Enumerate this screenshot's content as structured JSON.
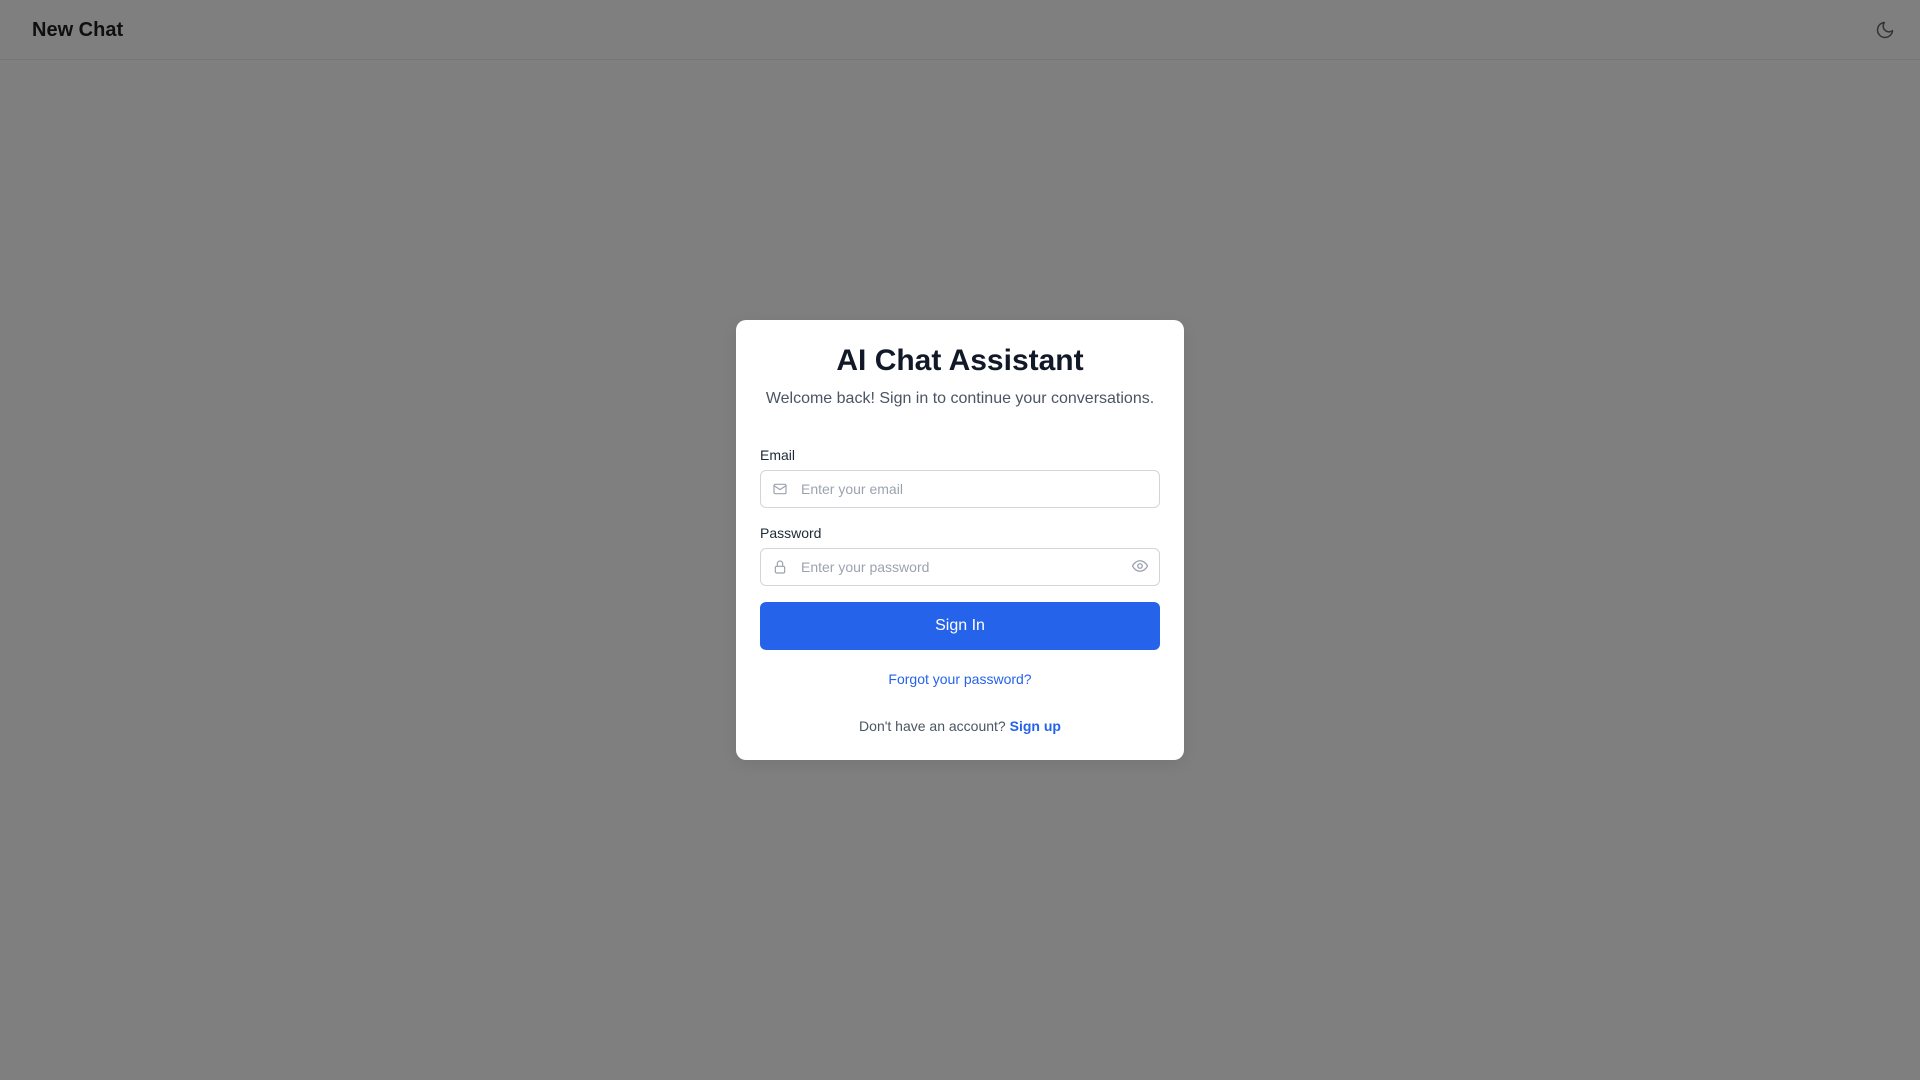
{
  "header": {
    "title": "New Chat",
    "theme_toggle_icon": "moon-icon"
  },
  "login": {
    "title": "AI Chat Assistant",
    "subtitle": "Welcome back! Sign in to continue your conversations.",
    "email": {
      "label": "Email",
      "placeholder": "Enter your email",
      "value": "",
      "icon": "mail-icon"
    },
    "password": {
      "label": "Password",
      "placeholder": "Enter your password",
      "value": "",
      "icon": "lock-icon",
      "toggle_icon": "eye-icon"
    },
    "submit_label": "Sign In",
    "forgot_label": "Forgot your password?",
    "signup_prompt": "Don't have an account?",
    "signup_label": "Sign up"
  },
  "colors": {
    "backdrop": "#7f7f7f",
    "accent": "#2563eb",
    "card": "#ffffff"
  }
}
